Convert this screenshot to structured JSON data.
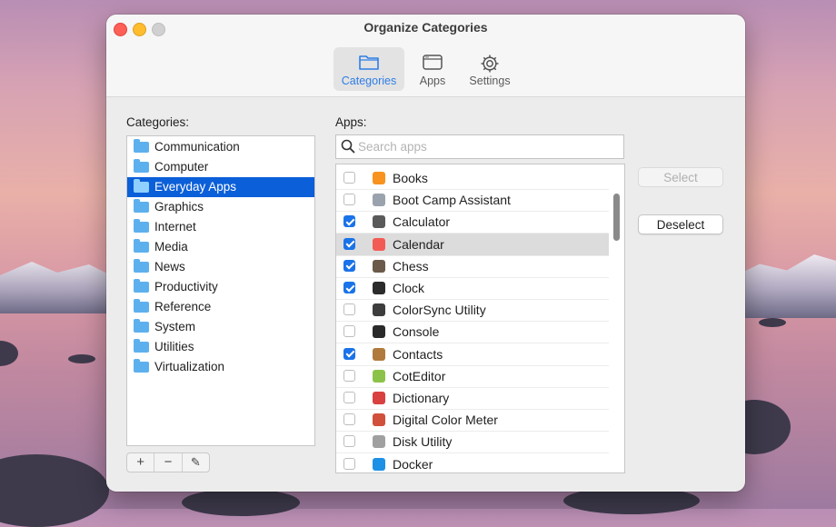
{
  "window": {
    "title": "Organize Categories"
  },
  "toolbar": {
    "tabs": [
      {
        "label": "Categories",
        "icon": "folder-icon",
        "active": true
      },
      {
        "label": "Apps",
        "icon": "window-icon",
        "active": false
      },
      {
        "label": "Settings",
        "icon": "gear-icon",
        "active": false
      }
    ],
    "accent_color": "#2f7ee6"
  },
  "categories": {
    "heading": "Categories:",
    "selected": "Everyday Apps",
    "items": [
      "Communication",
      "Computer",
      "Everyday Apps",
      "Graphics",
      "Internet",
      "Media",
      "News",
      "Productivity",
      "Reference",
      "System",
      "Utilities",
      "Virtualization"
    ],
    "controls": {
      "add": "+",
      "remove": "−",
      "edit": "✎"
    }
  },
  "apps": {
    "heading": "Apps:",
    "search_placeholder": "Search apps",
    "search_value": "",
    "items": [
      {
        "name": "Books",
        "checked": false,
        "icon": "books-icon",
        "color": "#f7931e"
      },
      {
        "name": "Boot Camp Assistant",
        "checked": false,
        "icon": "bootcamp-icon",
        "color": "#9aa3ad"
      },
      {
        "name": "Calculator",
        "checked": true,
        "icon": "calculator-icon",
        "color": "#5a5a5a"
      },
      {
        "name": "Calendar",
        "checked": true,
        "icon": "calendar-icon",
        "color": "#f25b55",
        "highlighted": true
      },
      {
        "name": "Chess",
        "checked": true,
        "icon": "chess-icon",
        "color": "#6b5a4a"
      },
      {
        "name": "Clock",
        "checked": true,
        "icon": "clock-icon",
        "color": "#2b2b2b"
      },
      {
        "name": "ColorSync Utility",
        "checked": false,
        "icon": "colorsync-icon",
        "color": "#3d3d3d"
      },
      {
        "name": "Console",
        "checked": false,
        "icon": "console-icon",
        "color": "#2a2a2a"
      },
      {
        "name": "Contacts",
        "checked": true,
        "icon": "contacts-icon",
        "color": "#b07a3c"
      },
      {
        "name": "CotEditor",
        "checked": false,
        "icon": "coteditor-icon",
        "color": "#8bc34a"
      },
      {
        "name": "Dictionary",
        "checked": false,
        "icon": "dictionary-icon",
        "color": "#d94040"
      },
      {
        "name": "Digital Color Meter",
        "checked": false,
        "icon": "colormeter-icon",
        "color": "#d0503c"
      },
      {
        "name": "Disk Utility",
        "checked": false,
        "icon": "diskutility-icon",
        "color": "#a0a0a0"
      },
      {
        "name": "Docker",
        "checked": false,
        "icon": "docker-icon",
        "color": "#1d91e6"
      }
    ]
  },
  "buttons": {
    "select": "Select",
    "deselect": "Deselect"
  }
}
